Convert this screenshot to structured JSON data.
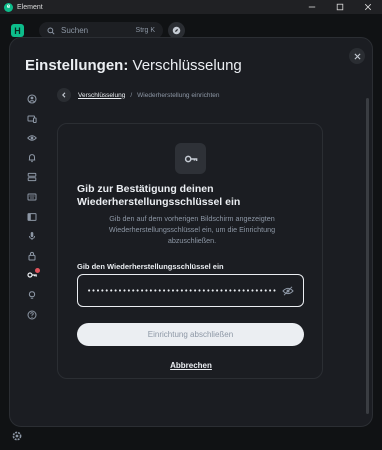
{
  "window": {
    "title": "Element",
    "app_icon_letter": "e"
  },
  "background": {
    "avatar_letter": "H",
    "search_placeholder": "Suchen",
    "search_shortcut": "Strg K"
  },
  "dialog": {
    "title_prefix": "Einstellungen:",
    "title_section": "Verschlüsselung",
    "breadcrumb": {
      "parent": "Verschlüsselung",
      "separator": "/",
      "current": "Wiederherstellung einrichten"
    },
    "heading": "Gib zur Bestätigung deinen Wiederherstellungsschlüssel ein",
    "description": "Gib den auf dem vorherigen Bildschirm angezeigten Wiederherstellungsschlüssel ein, um die Einrichtung abzuschließen.",
    "field_label": "Gib den Wiederherstellungsschlüssel ein",
    "key_value": "••••••••••••••••••••••••••••••••••••••••••••••••",
    "submit_label": "Einrichtung abschließen",
    "cancel_label": "Abbrechen"
  },
  "nav_icons": [
    "account-icon",
    "sessions-icon",
    "appearance-icon",
    "notifications-icon",
    "preferences-icon",
    "keyboard-icon",
    "sidebar-icon",
    "voice-video-icon",
    "security-icon",
    "encryption-key-icon",
    "labs-icon",
    "help-icon"
  ],
  "colors": {
    "accent": "#0dbd8b",
    "alert_dot": "#e0535c",
    "dialog_bg": "#1b1d22",
    "text_secondary": "#8d97a5"
  }
}
